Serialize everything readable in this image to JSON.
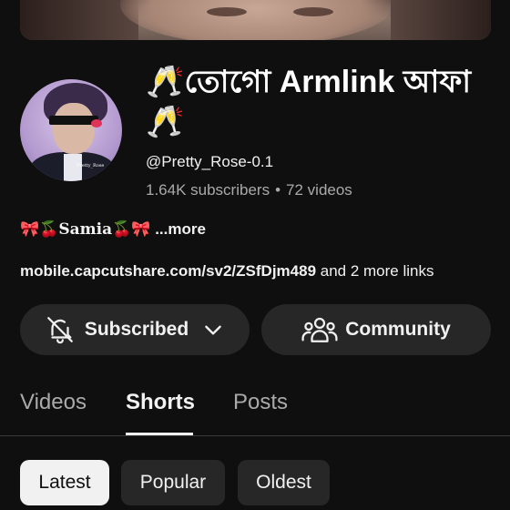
{
  "channel": {
    "name": "🥂তোগো Armlink আফা🥂",
    "handle": "@Pretty_Rose-0.1",
    "subscribers": "1.64K subscribers",
    "separator": "•",
    "videos": "72 videos",
    "avatar_tag": "Pretty_Rose"
  },
  "description": {
    "emoji_prefix": "🎀🍒",
    "name": "Samia",
    "emoji_suffix": "🍒🎀",
    "more": "...more"
  },
  "links": {
    "url": "mobile.capcutshare.com/sv2/ZSfDjm489",
    "extra": " and 2 more links"
  },
  "buttons": {
    "subscribed": "Subscribed",
    "community": "Community"
  },
  "tabs": [
    "Videos",
    "Shorts",
    "Posts"
  ],
  "active_tab": "Shorts",
  "filters": [
    "Latest",
    "Popular",
    "Oldest"
  ],
  "selected_filter": "Latest",
  "icons": {
    "subscribed": "bell-off-icon",
    "dropdown": "chevron-down-icon",
    "community": "people-icon"
  },
  "colors": {
    "background": "#0f0f0f",
    "button": "#272727",
    "secondary_text": "#aaaaaa",
    "selected_chip": "#f1f1f1"
  }
}
